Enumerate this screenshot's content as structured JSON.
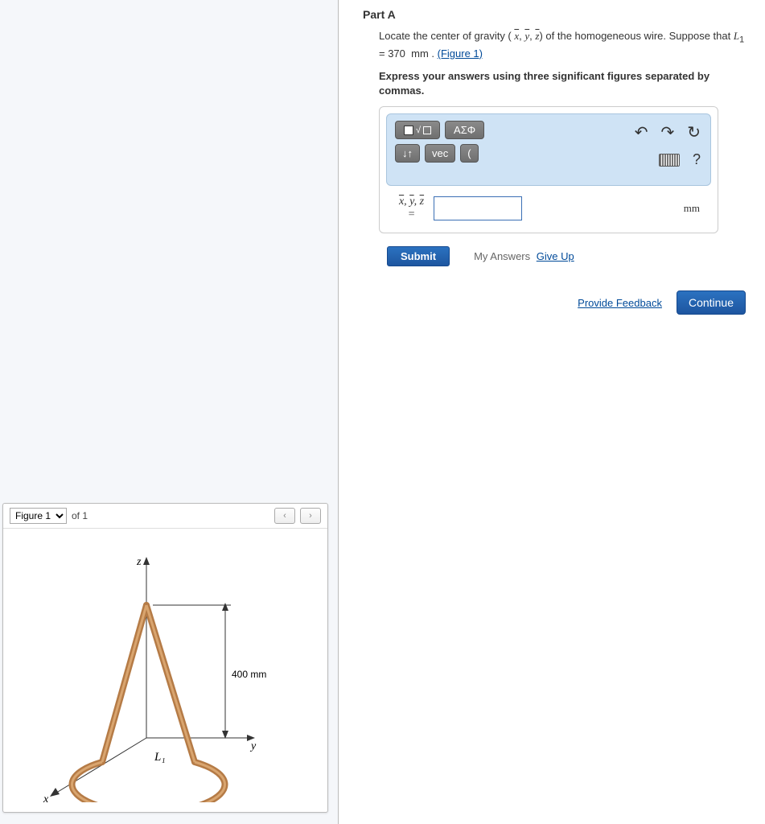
{
  "part": {
    "title": "Part A",
    "prompt_1": "Locate the center of gravity ( x̄, ȳ, z̄) of the homogeneous wire. Suppose that L₁ = 370  mm . ",
    "figure_link": "(Figure 1)",
    "prompt_2": "Express your answers using three significant figures separated by commas."
  },
  "toolbar": {
    "template_label": "▢√▢",
    "greek_label": "ΑΣΦ",
    "undo": "↶",
    "redo": "↷",
    "reset": "↻",
    "arrows": "↓↑",
    "vec": "vec",
    "paren": "(",
    "help": "?"
  },
  "answer": {
    "lhs_top": "x̄, ȳ, z̄",
    "lhs_bottom": "=",
    "value": "",
    "units": "mm"
  },
  "buttons": {
    "submit": "Submit",
    "my_answers": "My Answers",
    "give_up": "Give Up",
    "feedback": "Provide Feedback",
    "continue": "Continue"
  },
  "figure": {
    "select": "Figure 1",
    "of": "of 1",
    "prev": "‹",
    "next": "›",
    "z": "z",
    "y": "y",
    "x": "x",
    "L1": "L₁",
    "dim": "400 mm"
  }
}
